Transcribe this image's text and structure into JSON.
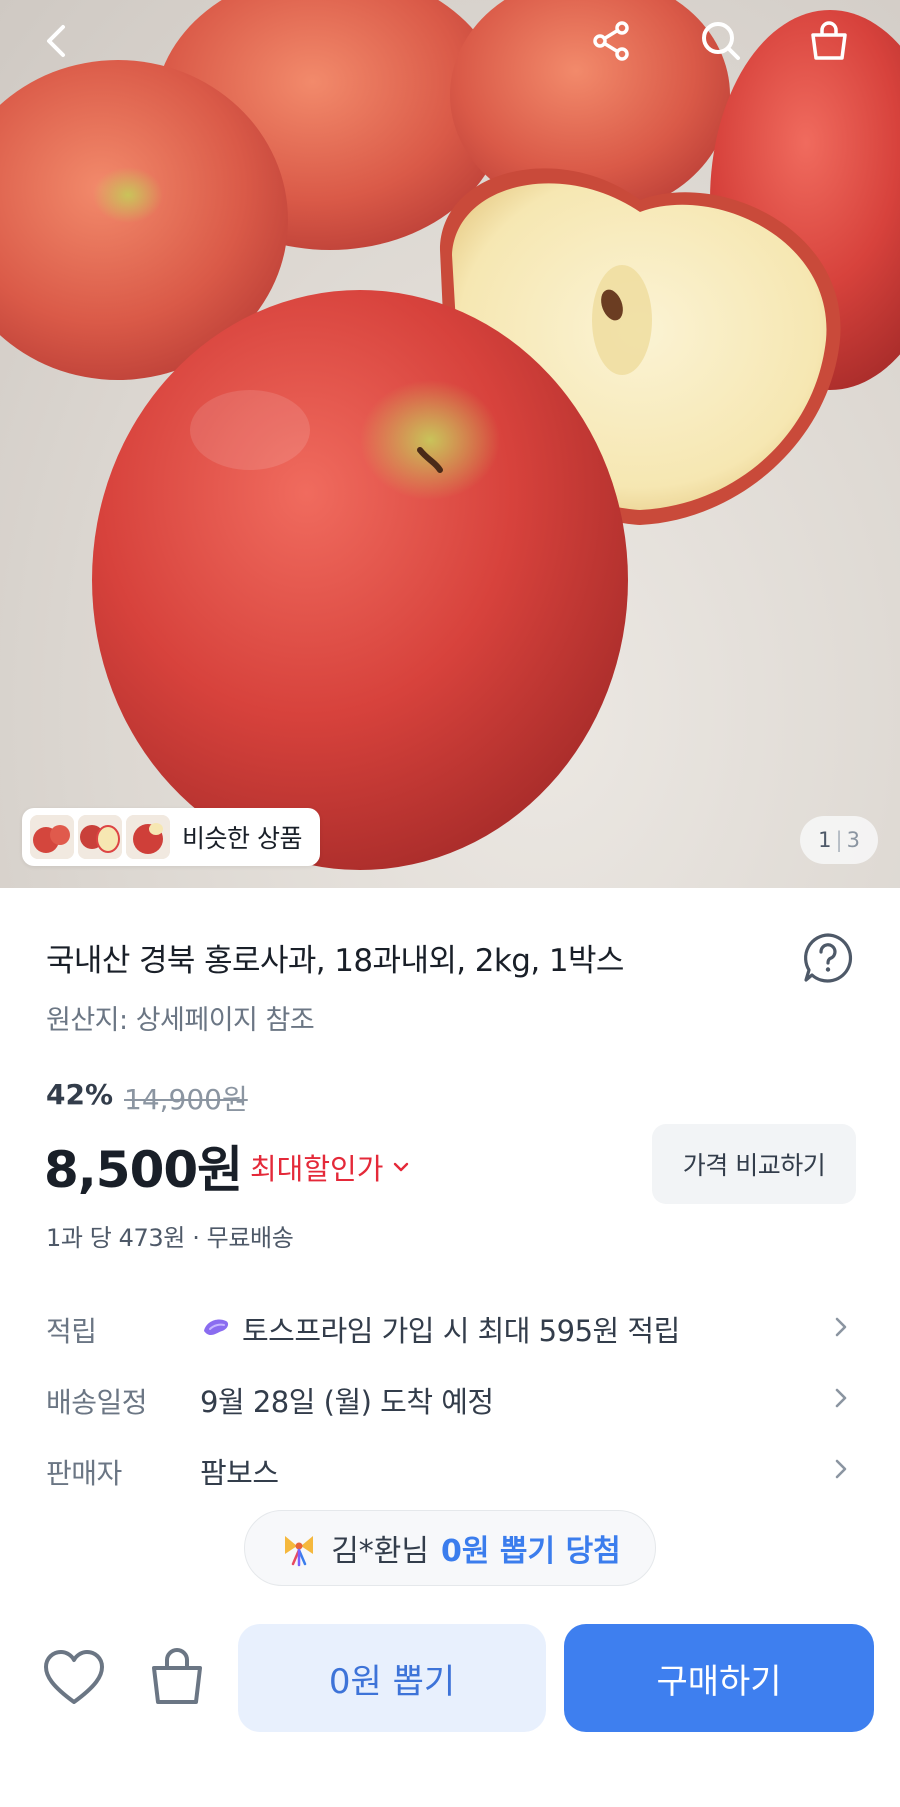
{
  "hero": {
    "similar_label": "비슷한 상품",
    "pager_current": "1",
    "pager_total": "3"
  },
  "product": {
    "title": "국내산 경북 홍로사과, 18과내외, 2kg, 1박스",
    "origin": "원산지: 상세페이지 참조",
    "discount_rate": "42%",
    "original_price": "14,900원",
    "price": "8,500원",
    "max_discount_label": "최대할인가",
    "compare_label": "가격 비교하기",
    "per_unit": "1과 당 473원 · 무료배송"
  },
  "details": [
    {
      "label": "적립",
      "value": "토스프라임 가입 시 최대 595원 적립"
    },
    {
      "label": "배송일정",
      "value": "9월 28일 (월) 도착 예정"
    },
    {
      "label": "판매자",
      "value": "팜보스"
    }
  ],
  "winner": {
    "name": "김*환님",
    "prize": "0원 뽑기 당첨"
  },
  "actions": {
    "draw_label": "0원 뽑기",
    "buy_label": "구매하기"
  },
  "colors": {
    "accent": "#3e7fef",
    "discount_red": "#e42939",
    "draw_bg": "#e8f0fd",
    "prime_purple": "#8a6cf0"
  },
  "icons": [
    "back-icon",
    "share-icon",
    "search-icon",
    "bag-icon",
    "help-icon",
    "chevron-right-icon",
    "heart-icon",
    "cart-icon",
    "toss-prime-icon",
    "confetti-icon"
  ]
}
